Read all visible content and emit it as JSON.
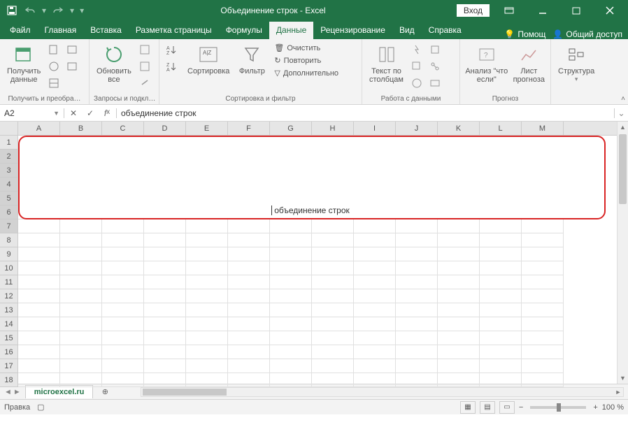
{
  "title": "Объединение строк  -  Excel",
  "login": "Вход",
  "menu": {
    "file": "Файл",
    "home": "Главная",
    "insert": "Вставка",
    "layout": "Разметка страницы",
    "formulas": "Формулы",
    "data": "Данные",
    "review": "Рецензирование",
    "view": "Вид",
    "help": "Справка",
    "tellme": "Помощ",
    "share": "Общий доступ"
  },
  "ribbon": {
    "group1": {
      "get_data": "Получить\nданные",
      "label": "Получить и преобра…"
    },
    "group2": {
      "refresh": "Обновить\nвсе",
      "label": "Запросы и подкл…"
    },
    "group3": {
      "sort": "Сортировка",
      "filter": "Фильтр",
      "clear": "Очистить",
      "reapply": "Повторить",
      "advanced": "Дополнительно",
      "label": "Сортировка и фильтр"
    },
    "group4": {
      "text_to_cols": "Текст по\nстолбцам",
      "label": "Работа с данными"
    },
    "group5": {
      "whatif": "Анализ \"что\nесли\"",
      "forecast": "Лист\nпрогноза",
      "label": "Прогноз"
    },
    "group6": {
      "outline": "Структура",
      "label": ""
    }
  },
  "namebox": "A2",
  "formula": "объединение строк",
  "merged_text": "объединение строк",
  "columns": [
    "A",
    "B",
    "C",
    "D",
    "E",
    "F",
    "G",
    "H",
    "I",
    "J",
    "K",
    "L",
    "M"
  ],
  "rows": [
    1,
    2,
    3,
    4,
    5,
    6,
    7,
    8,
    9,
    10,
    11,
    12,
    13,
    14,
    15,
    16,
    17,
    18
  ],
  "sheet": "microexcel.ru",
  "status": "Правка",
  "zoom": "100 %"
}
